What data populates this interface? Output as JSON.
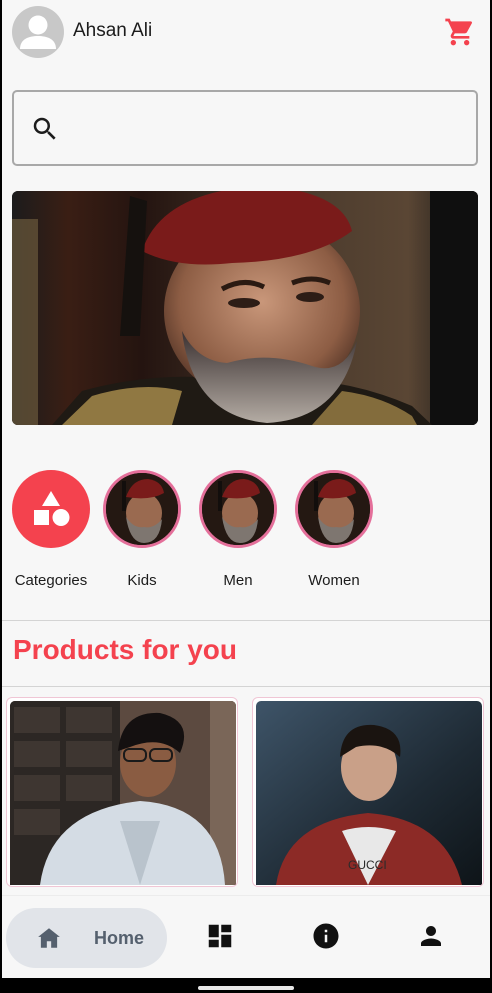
{
  "header": {
    "username": "Ahsan Ali",
    "avatar_icon": "person-icon",
    "cart_icon": "shopping-cart-icon"
  },
  "search": {
    "icon": "search-icon",
    "value": "",
    "placeholder": ""
  },
  "banner": {
    "image_description": "promotional-banner-image"
  },
  "categories": [
    {
      "label": "Categories",
      "icon": "shapes-icon"
    },
    {
      "label": "Kids",
      "icon": "category-image"
    },
    {
      "label": "Men",
      "icon": "category-image"
    },
    {
      "label": "Women",
      "icon": "category-image"
    }
  ],
  "products_section": {
    "title": "Products for you"
  },
  "bottom_nav": {
    "items": [
      {
        "label": "Home",
        "icon": "home-icon",
        "active": true
      },
      {
        "label": "",
        "icon": "dashboard-icon",
        "active": false
      },
      {
        "label": "",
        "icon": "info-icon",
        "active": false
      },
      {
        "label": "",
        "icon": "person-icon",
        "active": false
      }
    ]
  },
  "colors": {
    "accent": "#f4424e",
    "background": "#f7f7f7",
    "text": "#1c1c1c",
    "nav_active_bg": "#e1e4e9",
    "category_border": "#e46f9a"
  }
}
